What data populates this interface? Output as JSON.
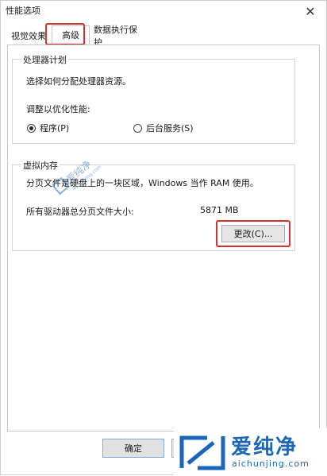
{
  "window": {
    "title": "性能选项",
    "close_glyph": "✕"
  },
  "tabs": [
    {
      "label": "视觉效果",
      "selected": false
    },
    {
      "label": "高级",
      "selected": true
    },
    {
      "label": "数据执行保护",
      "selected": false
    }
  ],
  "processor": {
    "group_title": "处理器计划",
    "description": "选择如何分配处理器资源。",
    "adjust_label": "调整以优化性能:",
    "options": [
      {
        "label": "程序(P)",
        "checked": true
      },
      {
        "label": "后台服务(S)",
        "checked": false
      }
    ]
  },
  "virtual_memory": {
    "group_title": "虚拟内存",
    "description": "分页文件是硬盘上的一块区域，Windows 当作 RAM 使用。",
    "total_label": "所有驱动器总分页文件大小:",
    "total_value": "5871 MB",
    "change_button": "更改(C)..."
  },
  "footer": {
    "ok_button": "确定"
  },
  "watermark": {
    "brand": "爱纯净",
    "url": "aichunjing.com",
    "accent": "#1a66b8",
    "center_brand": "爱纯净",
    "center_url": "aichunjing.com"
  },
  "colors": {
    "highlight": "#d8312b",
    "accent": "#1a66b8"
  }
}
